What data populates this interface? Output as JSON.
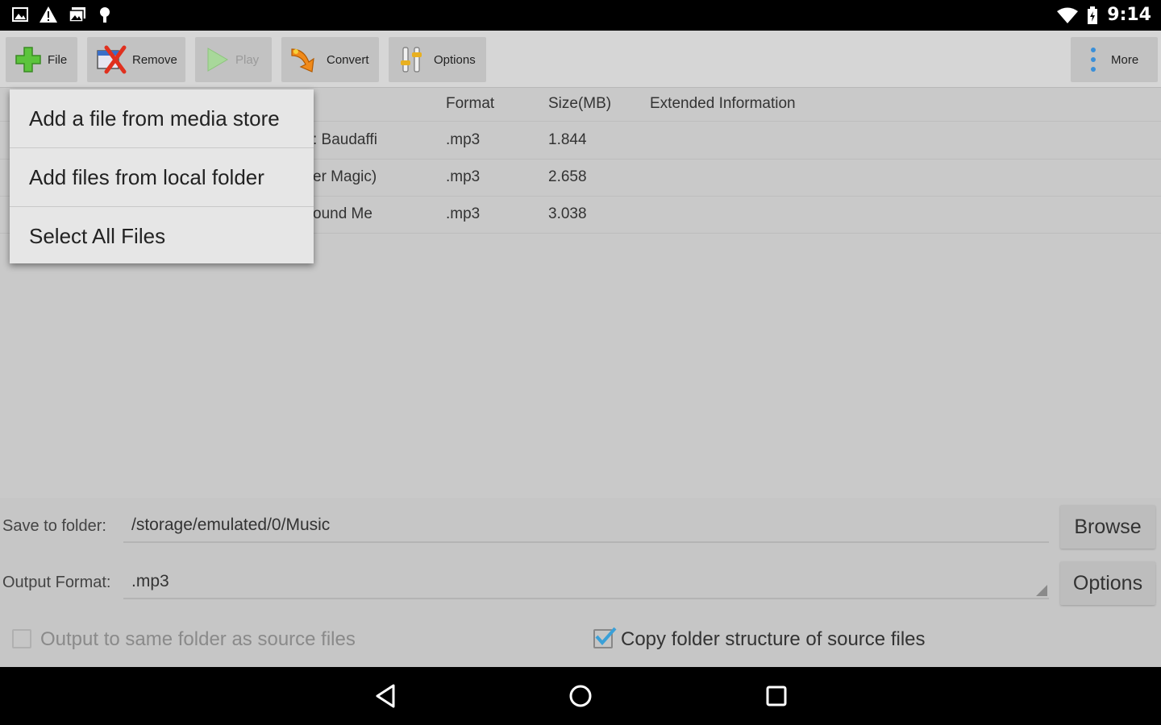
{
  "status_bar": {
    "time": "9:14"
  },
  "toolbar": {
    "file_label": "File",
    "remove_label": "Remove",
    "play_label": "Play",
    "convert_label": "Convert",
    "options_label": "Options",
    "more_label": "More"
  },
  "table": {
    "headers": {
      "format": "Format",
      "size": "Size(MB)",
      "extended": "Extended Information"
    },
    "rows": [
      {
        "name": ": Baudaffi",
        "format": ".mp3",
        "size": "1.844"
      },
      {
        "name": "er Magic)",
        "format": ".mp3",
        "size": "2.658"
      },
      {
        "name": "ound Me",
        "format": ".mp3",
        "size": "3.038"
      }
    ]
  },
  "popup_menu": {
    "items": [
      "Add a file from media store",
      "Add files from local folder",
      "Select All Files"
    ]
  },
  "bottom": {
    "save_label": "Save to folder:",
    "save_value": "/storage/emulated/0/Music",
    "browse_label": "Browse",
    "format_label": "Output Format:",
    "format_value": ".mp3",
    "options_label": "Options",
    "same_folder_label": "Output to same folder as source files",
    "copy_structure_label": "Copy folder structure of source files",
    "copy_structure_checked": true,
    "same_folder_checked": false
  },
  "colors": {
    "accent": "#3aa0d8"
  }
}
